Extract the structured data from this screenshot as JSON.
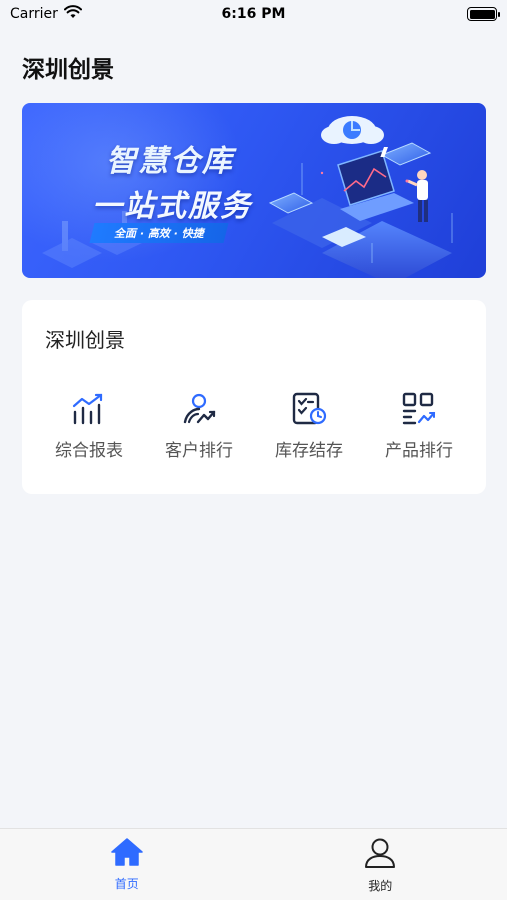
{
  "status_bar": {
    "carrier": "Carrier",
    "time": "6:16 PM"
  },
  "header": {
    "title": "深圳创景"
  },
  "banner": {
    "headline": "智慧仓库",
    "subheadline": "一站式服务",
    "tagline": "全面 · 高效 · 快捷"
  },
  "card": {
    "title": "深圳创景",
    "shortcuts": [
      {
        "label": "综合报表",
        "icon": "bar-chart-trend-icon"
      },
      {
        "label": "客户排行",
        "icon": "customer-rank-icon"
      },
      {
        "label": "库存结存",
        "icon": "inventory-clock-icon"
      },
      {
        "label": "产品排行",
        "icon": "product-rank-icon"
      }
    ]
  },
  "tab_bar": {
    "tabs": [
      {
        "label": "首页",
        "icon": "home-icon",
        "active": true
      },
      {
        "label": "我的",
        "icon": "person-icon",
        "active": false
      }
    ]
  },
  "colors": {
    "accent": "#2f6bff",
    "background": "#f3f5f9",
    "banner": "#2e57f2"
  }
}
